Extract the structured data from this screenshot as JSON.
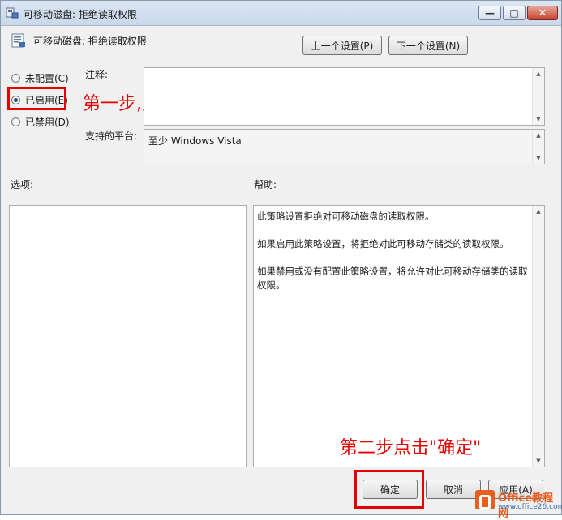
{
  "window": {
    "title": "可移动磁盘: 拒绝读取权限",
    "minimize_glyph": "—",
    "maximize_glyph": "□",
    "close_glyph": "✕"
  },
  "header": {
    "policy_title": "可移动磁盘: 拒绝读取权限",
    "prev_button": "上一个设置(P)",
    "next_button": "下一个设置(N)"
  },
  "state": {
    "options": [
      {
        "label": "未配置(C)",
        "checked": false
      },
      {
        "label": "已启用(E)",
        "checked": true
      },
      {
        "label": "已禁用(D)",
        "checked": false
      }
    ]
  },
  "comment": {
    "label": "注释:",
    "value": ""
  },
  "platform": {
    "label": "支持的平台:",
    "value": "至少 Windows Vista"
  },
  "options_panel": {
    "label": "选项:"
  },
  "help_panel": {
    "label": "帮助:",
    "paragraphs": [
      "此策略设置拒绝对可移动磁盘的读取权限。",
      "如果启用此策略设置，将拒绝对此可移动存储类的读取权限。",
      "如果禁用或没有配置此策略设置，将允许对此可移动存储类的读取权限。"
    ]
  },
  "footer": {
    "ok_button": "确定",
    "cancel_button": "取消",
    "apply_button": "应用(A)"
  },
  "annotations": {
    "step1": "第一步,点击\"已启用\"",
    "step2": "第二步点击\"确定\""
  },
  "watermark": {
    "brand": "Office教程网",
    "url": "www.office26.com"
  },
  "colors": {
    "annotation": "#e60000",
    "logo_orange": "#e95d1f",
    "logo_blue": "#3a6db0"
  },
  "icons": {
    "title": "group-policy-icon",
    "policy": "policy-setting-icon"
  }
}
